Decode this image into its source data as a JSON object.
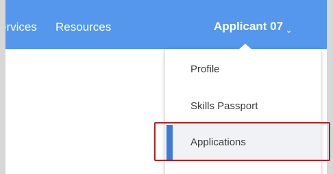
{
  "nav": {
    "services_label": "ervices",
    "resources_label": "Resources"
  },
  "user_menu": {
    "label": "Applicant 07",
    "chevron_icon": "chevron-down-icon"
  },
  "dropdown": {
    "items": [
      {
        "label": "Profile"
      },
      {
        "label": "Skills Passport"
      },
      {
        "label": "Applications",
        "active": true
      }
    ]
  },
  "colors": {
    "topbar": "#5497ec",
    "active_indicator": "#3e78d9",
    "highlight_border": "#b21f24"
  }
}
